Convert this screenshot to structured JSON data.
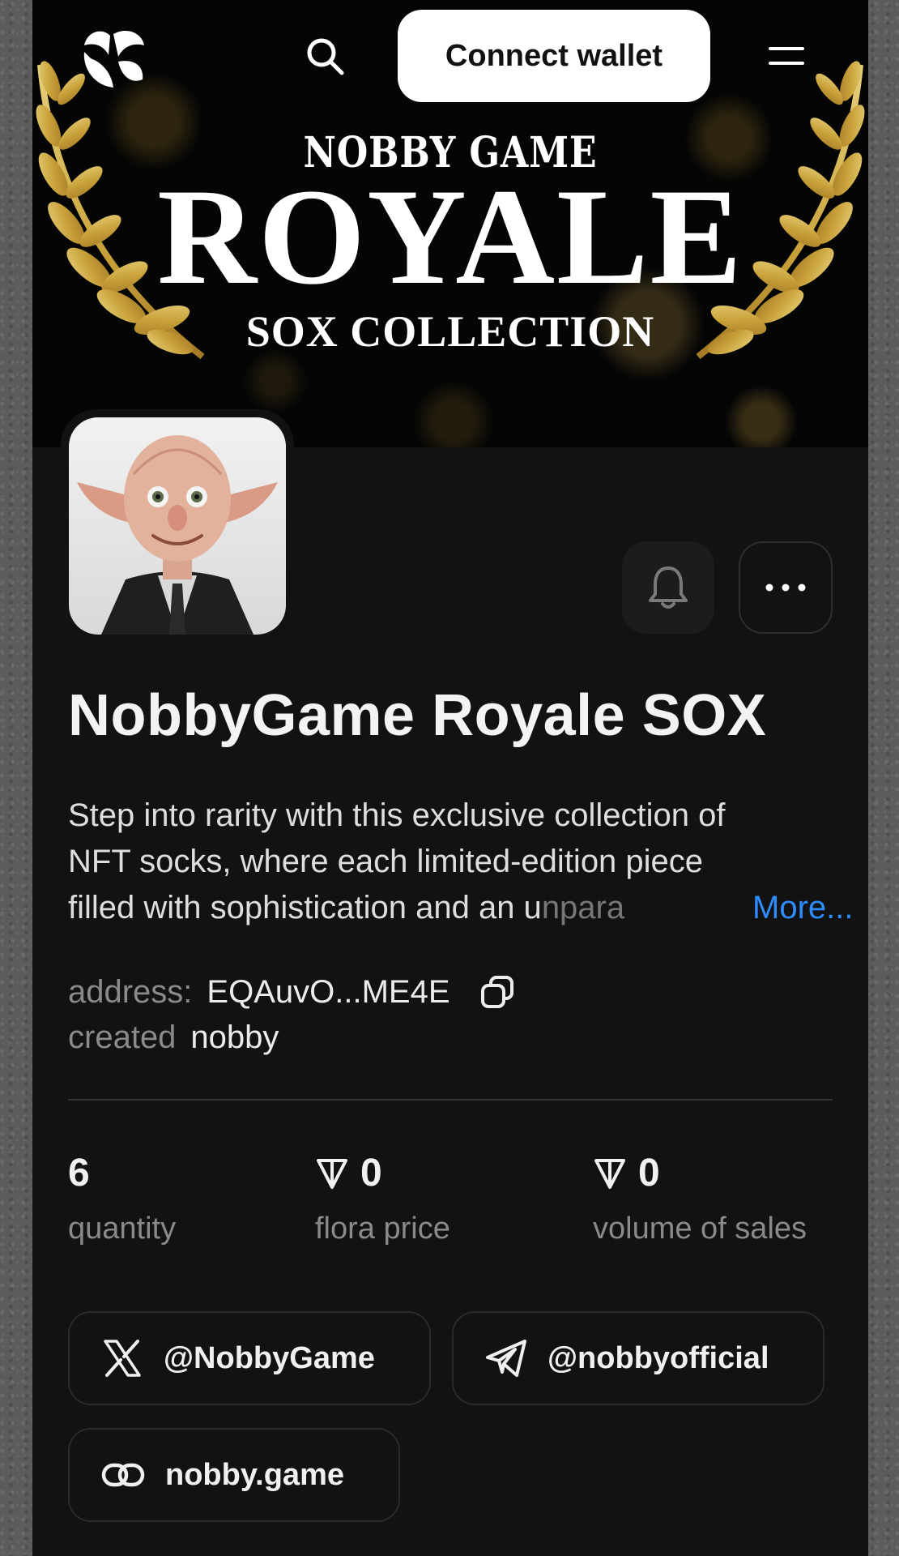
{
  "nav": {
    "connect_label": "Connect wallet"
  },
  "banner": {
    "kicker": "NOBBY GAME",
    "title": "ROYALE",
    "subtitle": "SOX COLLECTION"
  },
  "collection": {
    "name": "NobbyGame Royale SOX",
    "description_lines": [
      "Step into rarity with this exclusive collection of",
      "NFT socks, where each limited-edition piece",
      "filled with sophistication and an unpara"
    ],
    "more_label": "More...",
    "address_label": "address:",
    "address_value": "EQAuvO...ME4E",
    "created_label": "created",
    "created_value": "nobby"
  },
  "stats": [
    {
      "value": "6",
      "label": "quantity",
      "has_currency": false
    },
    {
      "value": "0",
      "label": "flora price",
      "has_currency": true
    },
    {
      "value": "0",
      "label": "volume of sales",
      "has_currency": true
    }
  ],
  "links": {
    "twitter": "@NobbyGame",
    "telegram": "@nobbyofficial",
    "website": "nobby.game"
  },
  "icons": {
    "logo": "nobby-logo-icon",
    "search": "search-icon",
    "menu": "hamburger-menu-icon",
    "bell": "bell-icon",
    "more": "more-dots-icon",
    "copy": "copy-icon",
    "currency": "ton-diamond-icon",
    "twitter": "x-logo-icon",
    "telegram": "telegram-icon",
    "website": "link-icon"
  },
  "colors": {
    "background": "#121212",
    "accent_link": "#2f8cff",
    "button_bg": "#ffffff",
    "laurel_gold": "#c9a23a"
  }
}
